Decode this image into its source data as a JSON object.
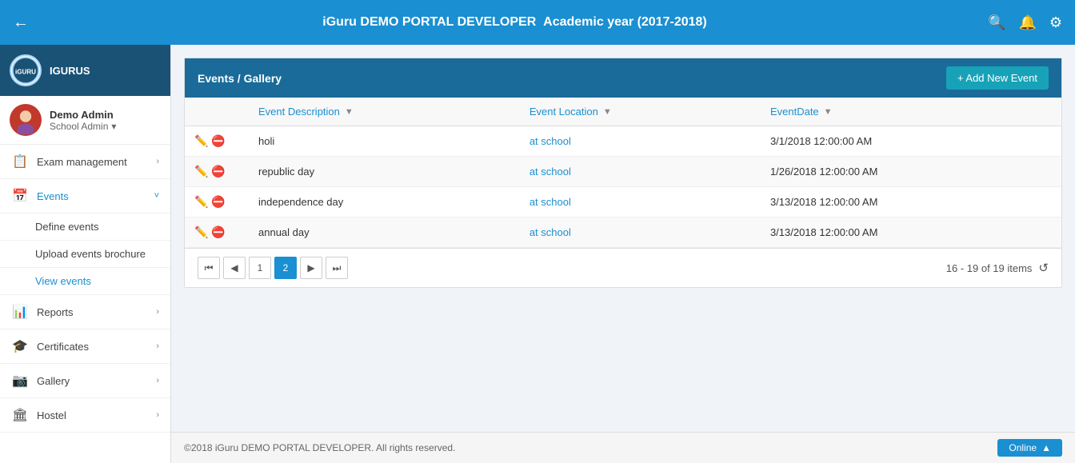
{
  "header": {
    "title": "iGuru DEMO PORTAL DEVELOPER",
    "subtitle": "Academic year (2017-2018)",
    "back_label": "←",
    "search_icon": "🔍",
    "bell_icon": "🔔",
    "gear_icon": "⚙"
  },
  "sidebar": {
    "brand_name": "IGURUS",
    "user_name": "Demo Admin",
    "user_role": "School Admin",
    "nav_items": [
      {
        "id": "exam",
        "icon": "📋",
        "label": "Exam management",
        "has_arrow": true,
        "active": false
      },
      {
        "id": "events",
        "icon": "📅",
        "label": "Events",
        "has_arrow": true,
        "active": true
      }
    ],
    "events_sub": [
      {
        "id": "define-events",
        "label": "Define events"
      },
      {
        "id": "upload-events",
        "label": "Upload events brochure"
      },
      {
        "id": "view-events",
        "label": "View events"
      }
    ],
    "nav_items2": [
      {
        "id": "reports",
        "icon": "📊",
        "label": "Reports",
        "has_arrow": true
      },
      {
        "id": "certificates",
        "icon": "🎓",
        "label": "Certificates",
        "has_arrow": true
      },
      {
        "id": "gallery",
        "icon": "📷",
        "label": "Gallery",
        "has_arrow": true
      },
      {
        "id": "hostel",
        "icon": "🏛",
        "label": "Hostel",
        "has_arrow": true
      }
    ]
  },
  "card": {
    "title": "Events / Gallery",
    "add_button_label": "+ Add New Event"
  },
  "table": {
    "columns": [
      {
        "id": "actions",
        "label": ""
      },
      {
        "id": "description",
        "label": "Event Description",
        "has_filter": true
      },
      {
        "id": "location",
        "label": "Event Location",
        "has_filter": true
      },
      {
        "id": "date",
        "label": "EventDate",
        "has_filter": true
      }
    ],
    "rows": [
      {
        "description": "holi",
        "location": "at school",
        "date": "3/1/2018 12:00:00 AM"
      },
      {
        "description": "republic day",
        "location": "at school",
        "date": "1/26/2018 12:00:00 AM"
      },
      {
        "description": "independence day",
        "location": "at school",
        "date": "3/13/2018 12:00:00 AM"
      },
      {
        "description": "annual day",
        "location": "at school",
        "date": "3/13/2018 12:00:00 AM"
      }
    ]
  },
  "pagination": {
    "first_icon": "⏮",
    "prev_icon": "◀",
    "next_icon": "▶",
    "last_icon": "⏭",
    "pages": [
      "1",
      "2"
    ],
    "active_page": "2",
    "info": "16 - 19 of 19 items",
    "refresh_icon": "↺"
  },
  "footer": {
    "copyright": "©2018 iGuru DEMO PORTAL DEVELOPER. All rights reserved.",
    "online_label": "Online",
    "chevron_icon": "▲"
  }
}
